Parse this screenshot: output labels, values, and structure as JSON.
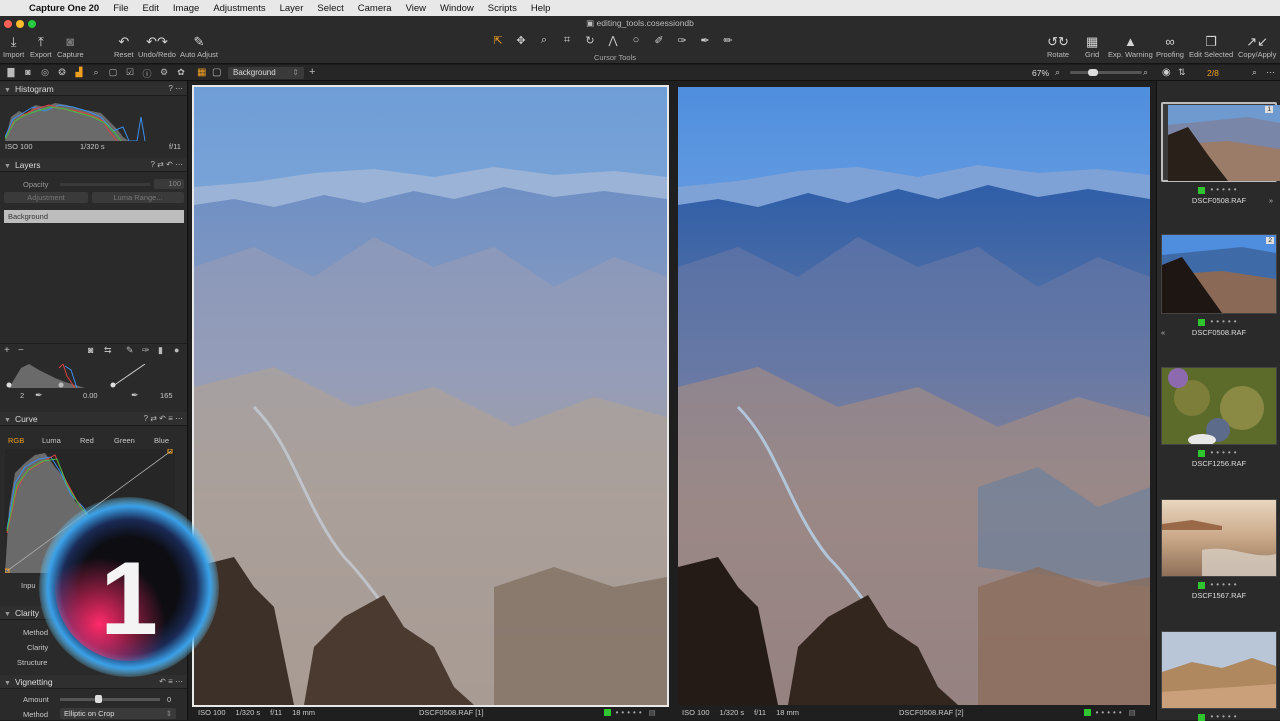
{
  "menubar": {
    "app_name": "Capture One 20",
    "items": [
      "File",
      "Edit",
      "Image",
      "Adjustments",
      "Layer",
      "Select",
      "Camera",
      "View",
      "Window",
      "Scripts",
      "Help"
    ]
  },
  "window": {
    "title": "editing_tools.cosessiondb"
  },
  "toolbar": {
    "import": "Import",
    "export": "Export",
    "capture": "Capture",
    "reset": "Reset",
    "undo_redo": "Undo/Redo",
    "auto_adjust": "Auto Adjust",
    "cursor_tools_label": "Cursor Tools",
    "rotate": "Rotate",
    "grid": "Grid",
    "exp_warning": "Exp. Warning",
    "proofing": "Proofing",
    "edit_selected": "Edit Selected",
    "copy_apply": "Copy/Apply"
  },
  "subbar": {
    "layer_select": "Background",
    "zoom": "67%",
    "counter": "2/8"
  },
  "left": {
    "histogram": {
      "title": "Histogram",
      "iso": "ISO 100",
      "shutter": "1/320 s",
      "aperture": "f/11"
    },
    "layers": {
      "title": "Layers",
      "opacity_label": "Opacity",
      "opacity_value": "100",
      "adjustment_btn": "Adjustment",
      "luma_btn": "Luma Range...",
      "background": "Background"
    },
    "levels": {
      "low": "2",
      "mid": "0.00",
      "high": "165"
    },
    "curve": {
      "title": "Curve",
      "tabs": [
        "RGB",
        "Luma",
        "Red",
        "Green",
        "Blue"
      ],
      "input_label": "Inpu"
    },
    "clarity": {
      "title": "Clarity",
      "method_label": "Method",
      "clarity_label": "Clarity",
      "structure_label": "Structure"
    },
    "vignetting": {
      "title": "Vignetting",
      "amount_label": "Amount",
      "amount_value": "0",
      "method_label": "Method",
      "method_value": "Elliptic on Crop"
    }
  },
  "viewer": {
    "left": {
      "iso": "ISO 100",
      "shutter": "1/320 s",
      "aperture": "f/11",
      "focal": "18 mm",
      "filename": "DSCF0508.RAF [1]"
    },
    "right": {
      "iso": "ISO 100",
      "shutter": "1/320 s",
      "aperture": "f/11",
      "focal": "18 mm",
      "filename": "DSCF0508.RAF [2]"
    }
  },
  "browser": {
    "thumbs": [
      {
        "num": "1",
        "name": "DSCF0508.RAF"
      },
      {
        "num": "2",
        "name": "DSCF0508.RAF"
      },
      {
        "num": "",
        "name": "DSCF1256.RAF"
      },
      {
        "num": "",
        "name": "DSCF1567.RAF"
      },
      {
        "num": "",
        "name": ""
      }
    ]
  },
  "logo": {
    "numeral": "1"
  },
  "colors": {
    "accent": "#f0a020",
    "green_tag": "#2ec52e",
    "panel": "#2a2a2a"
  }
}
